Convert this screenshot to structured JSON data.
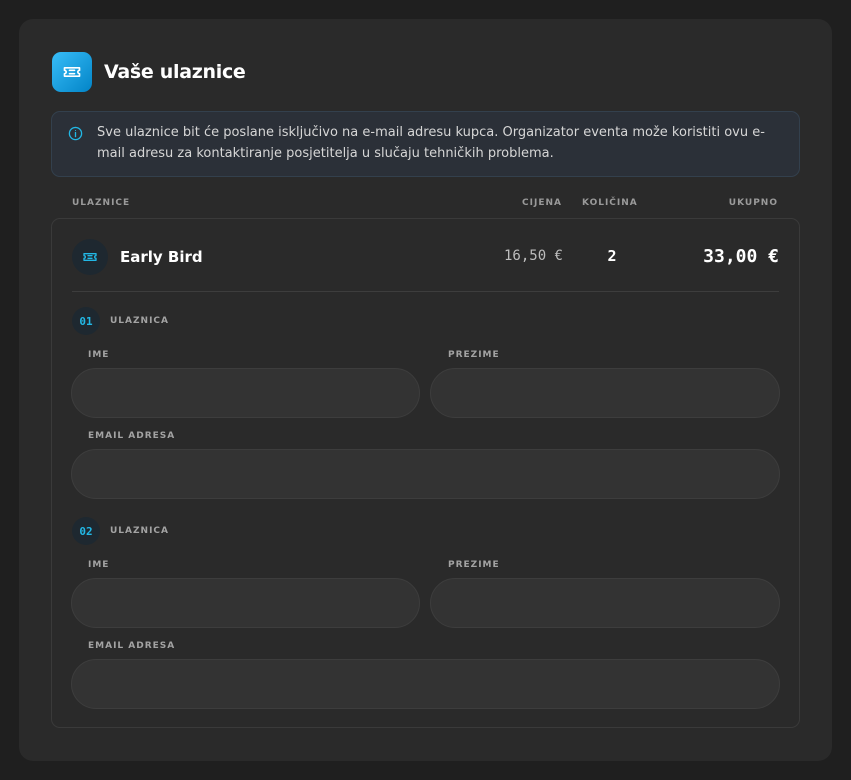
{
  "header": {
    "title": "Vaše ulaznice",
    "icon": "ticket-icon"
  },
  "notice": {
    "icon": "info-icon",
    "text": "Sve ulaznice bit će poslane isključivo na e-mail adresu kupca. Organizator eventa može koristiti ovu e-mail adresu za kontaktiranje posjetitelja u slučaju tehničkih problema."
  },
  "columns": {
    "tickets": "ULAZNICE",
    "price": "CIJENA",
    "quantity": "KOLIČINA",
    "total": "UKUPNO"
  },
  "ticket": {
    "name": "Early Bird",
    "price": "16,50 €",
    "quantity": "2",
    "total": "33,00 €"
  },
  "attendees": [
    {
      "number": "01",
      "label": "ULAZNICA",
      "first_name_label": "IME",
      "first_name_value": "",
      "last_name_label": "PREZIME",
      "last_name_value": "",
      "email_label": "EMAIL ADRESA",
      "email_value": ""
    },
    {
      "number": "02",
      "label": "ULAZNICA",
      "first_name_label": "IME",
      "first_name_value": "",
      "last_name_label": "PREZIME",
      "last_name_value": "",
      "email_label": "EMAIL ADRESA",
      "email_value": ""
    }
  ],
  "colors": {
    "accent": "#22b8e6",
    "card_bg": "#2a2a2a",
    "page_bg": "#1f1f1f"
  }
}
